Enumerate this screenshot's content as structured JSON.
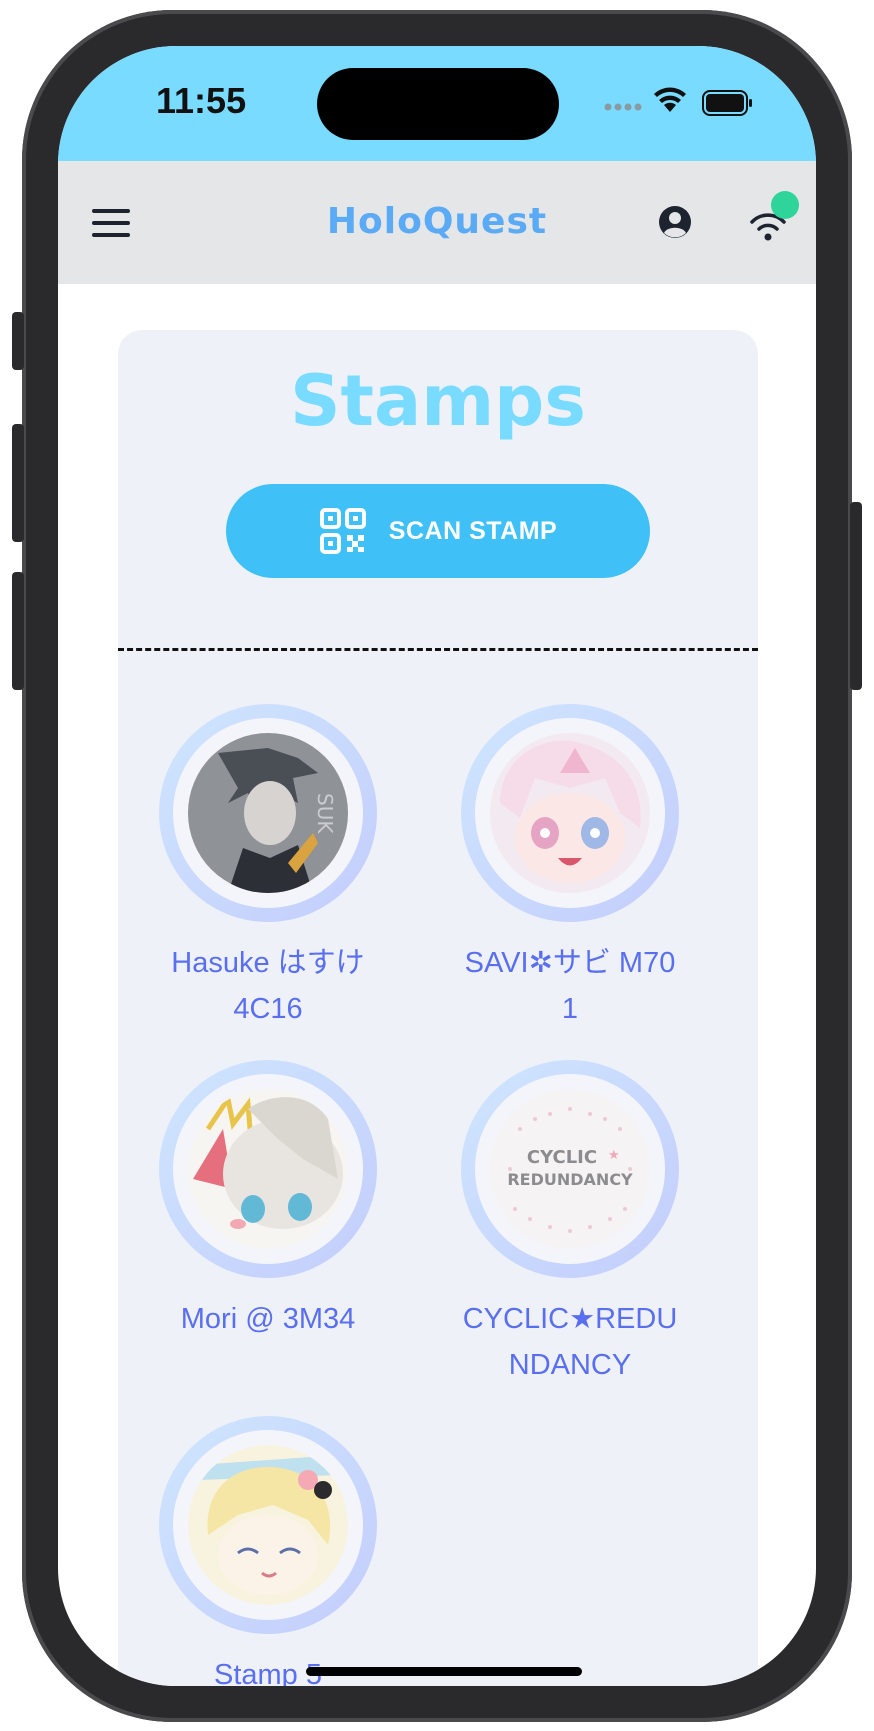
{
  "status_bar": {
    "time": "11:55"
  },
  "header": {
    "title": "HoloQuest",
    "menu_icon": "hamburger-menu-icon",
    "account_icon": "user-circle-icon",
    "connection_icon": "wifi-icon",
    "connection_status_color": "#2fd49a"
  },
  "page": {
    "title": "Stamps",
    "scan_button_label": "SCAN STAMP",
    "scan_icon": "qr-code-icon"
  },
  "stamps": [
    {
      "label": "Hasuke はすけ 4C16"
    },
    {
      "label": "SAVI✲サビ M701"
    },
    {
      "label": "Mori @ 3M34"
    },
    {
      "label": "CYCLIC★REDUNDANCY",
      "logo_line1": "CYCLIC",
      "logo_line2": "REDUNDANCY"
    },
    {
      "label": "Stamp 5"
    }
  ],
  "colors": {
    "status_bar_bg": "#79dbff",
    "header_bg": "#e4e6e7",
    "brand_title": "#5aaaf5",
    "page_title": "#79dbff",
    "scan_button_bg": "#3fc0f7",
    "stamp_label": "#5a6ef0",
    "card_bg": "#eef2f8"
  }
}
